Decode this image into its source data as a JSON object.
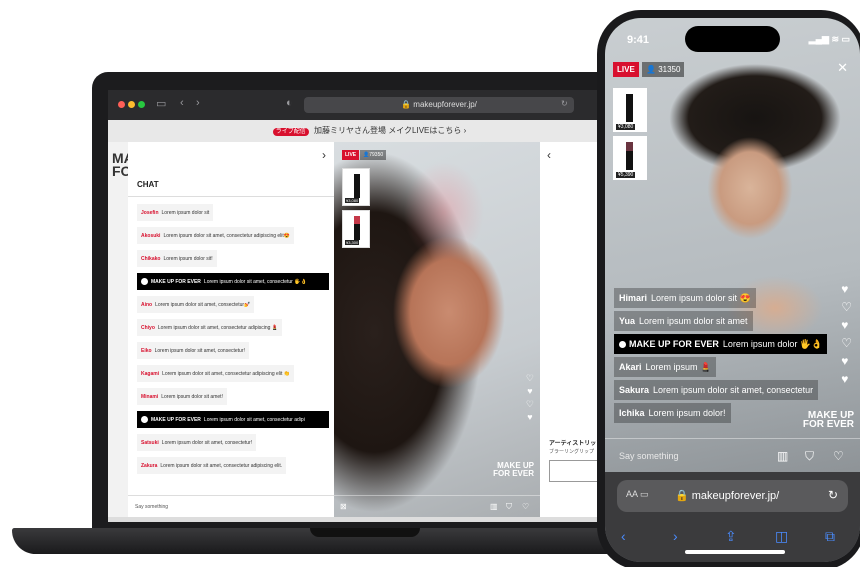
{
  "laptop": {
    "browser": {
      "url": "makeupforever.jp/"
    },
    "banner": {
      "badge": "ライブ配信",
      "text": "加藤ミリヤさん登場 メイクLIVEはこちら"
    },
    "side_logo": {
      "line1": "MA",
      "line2": "FOR"
    },
    "chat": {
      "title": "CHAT",
      "messages": [
        {
          "user": "Josefin",
          "text": "Lorem ipsum dolor sit",
          "brand": false
        },
        {
          "user": "Akosuki",
          "text": "Lorem ipsum dolor sit amet, consectetur adipiscing elit😍",
          "brand": false
        },
        {
          "user": "Chikako",
          "text": "Lorem ipsum dolor sit!",
          "brand": false
        },
        {
          "user": "MAKE UP FOR EVER",
          "text": "Lorem ipsum dolor sit amet, consectetur 🖐👌",
          "brand": true
        },
        {
          "user": "Aino",
          "text": "Lorem ipsum dolor sit amet, consectetur💅",
          "brand": false
        },
        {
          "user": "Chiyo",
          "text": "Lorem ipsum dolor sit amet, consectetur adipiscing 💄",
          "brand": false
        },
        {
          "user": "Eiko",
          "text": "Lorem ipsum dolor sit amet, consectetur!",
          "brand": false
        },
        {
          "user": "Kagami",
          "text": "Lorem ipsum dolor sit amet, consectetur adipiscing elit 👏",
          "brand": false
        },
        {
          "user": "Minami",
          "text": "Lorem ipsum dolor sit amet!",
          "brand": false
        },
        {
          "user": "MAKE UP FOR EVER",
          "text": "Lorem ipsum dolor sit amet, consectetur adipi",
          "brand": true
        },
        {
          "user": "Satsuki",
          "text": "Lorem ipsum dolor sit amet, consectetur!",
          "brand": false
        },
        {
          "user": "Zakura",
          "text": "Lorem ipsum dolor sit amet, consectetur adipiscing elit.",
          "brand": false
        }
      ],
      "input_placeholder": "Say something"
    },
    "video": {
      "live_badge": "LIVE",
      "viewers": "79350",
      "products": [
        {
          "price": "¥3,080"
        },
        {
          "price": "¥3,300"
        }
      ],
      "logo_line1": "MAKE UP",
      "logo_line2": "FOR EVER"
    },
    "product_panel": {
      "title": "アーティストリップ",
      "subtitle": "ブラーリングリップ"
    }
  },
  "phone": {
    "status": {
      "time": "9:41",
      "icons": "▂▄▆ ≋ ▭"
    },
    "live_badge": "LIVE",
    "viewers": "31350",
    "products": [
      {
        "price": "¥3,080"
      },
      {
        "price": "¥5,390"
      }
    ],
    "chat": [
      {
        "user": "Himari",
        "text": "Lorem ipsum dolor sit 😍",
        "brand": false
      },
      {
        "user": "Yua",
        "text": "Lorem ipsum dolor sit amet",
        "brand": false
      },
      {
        "user": "MAKE UP FOR EVER",
        "text": "Lorem ipsum dolor 🖐👌",
        "brand": true
      },
      {
        "user": "Akari",
        "text": "Lorem ipsum 💄",
        "brand": false
      },
      {
        "user": "Sakura",
        "text": "Lorem ipsum dolor sit amet, consectetur",
        "brand": false
      },
      {
        "user": "Ichika",
        "text": "Lorem ipsum dolor!",
        "brand": false
      }
    ],
    "input_placeholder": "Say something",
    "logo_line1": "MAKE UP",
    "logo_line2": "FOR EVER",
    "safari": {
      "aa": "AA",
      "url": "makeupforever.jp/"
    }
  }
}
